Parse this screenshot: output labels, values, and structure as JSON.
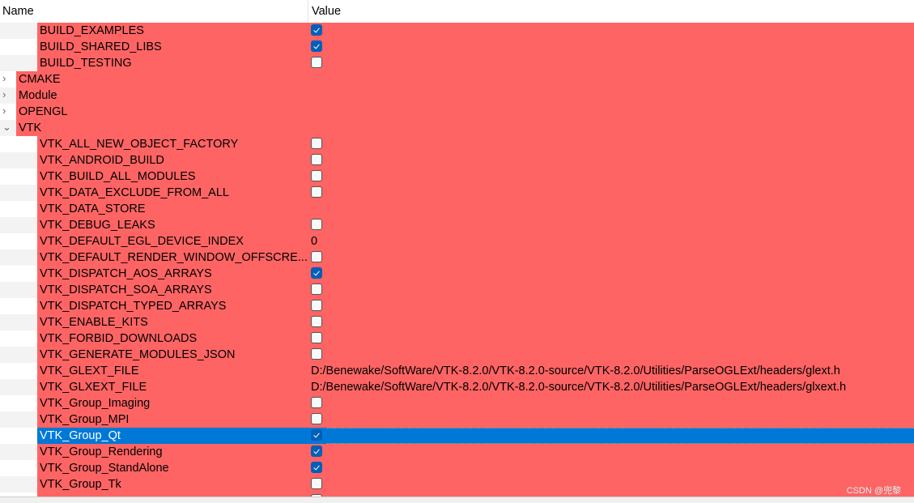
{
  "header": {
    "name": "Name",
    "value": "Value"
  },
  "colors": {
    "changed_row": "#ff6464",
    "selected_row": "#0078d7",
    "checkbox_on": "#005fb8"
  },
  "rows": [
    {
      "name": "BUILD_EXAMPLES",
      "level": 1,
      "type": "bool",
      "checked": true
    },
    {
      "name": "BUILD_SHARED_LIBS",
      "level": 1,
      "type": "bool",
      "checked": true
    },
    {
      "name": "BUILD_TESTING",
      "level": 1,
      "type": "bool",
      "checked": false
    },
    {
      "name": "CMAKE",
      "level": 0,
      "type": "group",
      "expanded": false
    },
    {
      "name": "Module",
      "level": 0,
      "type": "group",
      "expanded": false
    },
    {
      "name": "OPENGL",
      "level": 0,
      "type": "group",
      "expanded": false
    },
    {
      "name": "VTK",
      "level": 0,
      "type": "group",
      "expanded": true
    },
    {
      "name": "VTK_ALL_NEW_OBJECT_FACTORY",
      "level": 1,
      "type": "bool",
      "checked": false
    },
    {
      "name": "VTK_ANDROID_BUILD",
      "level": 1,
      "type": "bool",
      "checked": false
    },
    {
      "name": "VTK_BUILD_ALL_MODULES",
      "level": 1,
      "type": "bool",
      "checked": false
    },
    {
      "name": "VTK_DATA_EXCLUDE_FROM_ALL",
      "level": 1,
      "type": "bool",
      "checked": false
    },
    {
      "name": "VTK_DATA_STORE",
      "level": 1,
      "type": "text",
      "value": ""
    },
    {
      "name": "VTK_DEBUG_LEAKS",
      "level": 1,
      "type": "bool",
      "checked": false
    },
    {
      "name": "VTK_DEFAULT_EGL_DEVICE_INDEX",
      "level": 1,
      "type": "text",
      "value": "0"
    },
    {
      "name": "VTK_DEFAULT_RENDER_WINDOW_OFFSCRE...",
      "level": 1,
      "type": "bool",
      "checked": false
    },
    {
      "name": "VTK_DISPATCH_AOS_ARRAYS",
      "level": 1,
      "type": "bool",
      "checked": true
    },
    {
      "name": "VTK_DISPATCH_SOA_ARRAYS",
      "level": 1,
      "type": "bool",
      "checked": false
    },
    {
      "name": "VTK_DISPATCH_TYPED_ARRAYS",
      "level": 1,
      "type": "bool",
      "checked": false
    },
    {
      "name": "VTK_ENABLE_KITS",
      "level": 1,
      "type": "bool",
      "checked": false
    },
    {
      "name": "VTK_FORBID_DOWNLOADS",
      "level": 1,
      "type": "bool",
      "checked": false
    },
    {
      "name": "VTK_GENERATE_MODULES_JSON",
      "level": 1,
      "type": "bool",
      "checked": false
    },
    {
      "name": "VTK_GLEXT_FILE",
      "level": 1,
      "type": "text",
      "value": "D:/Benewake/SoftWare/VTK-8.2.0/VTK-8.2.0-source/VTK-8.2.0/Utilities/ParseOGLExt/headers/glext.h"
    },
    {
      "name": "VTK_GLXEXT_FILE",
      "level": 1,
      "type": "text",
      "value": "D:/Benewake/SoftWare/VTK-8.2.0/VTK-8.2.0-source/VTK-8.2.0/Utilities/ParseOGLExt/headers/glxext.h"
    },
    {
      "name": "VTK_Group_Imaging",
      "level": 1,
      "type": "bool",
      "checked": false
    },
    {
      "name": "VTK_Group_MPI",
      "level": 1,
      "type": "bool",
      "checked": false
    },
    {
      "name": "VTK_Group_Qt",
      "level": 1,
      "type": "bool",
      "checked": true,
      "selected": true
    },
    {
      "name": "VTK_Group_Rendering",
      "level": 1,
      "type": "bool",
      "checked": true
    },
    {
      "name": "VTK_Group_StandAlone",
      "level": 1,
      "type": "bool",
      "checked": true
    },
    {
      "name": "VTK_Group_Tk",
      "level": 1,
      "type": "bool",
      "checked": false
    },
    {
      "name": "",
      "level": 1,
      "type": "bool",
      "checked": false
    }
  ],
  "watermark": "CSDN @兜黎"
}
